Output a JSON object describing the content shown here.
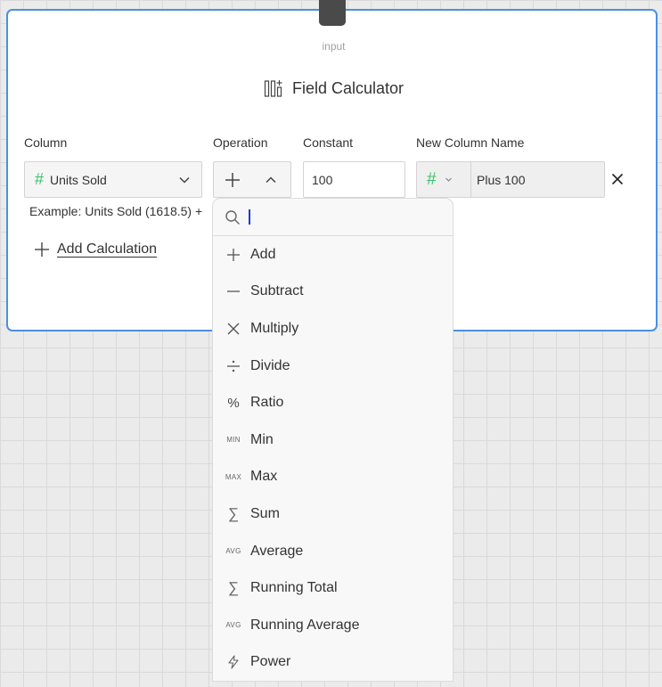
{
  "node": {
    "input_label": "input",
    "title": "Field Calculator",
    "title_icon": "field-calculator-icon"
  },
  "form": {
    "column_label": "Column",
    "operation_label": "Operation",
    "constant_label": "Constant",
    "new_column_label": "New Column Name",
    "column_value": "Units Sold",
    "column_type_icon": "#",
    "constant_value": "100",
    "new_column_type_icon": "#",
    "new_column_value": "Plus 100",
    "example": "Example: Units Sold (1618.5) +",
    "add_calculation": "Add Calculation"
  },
  "dropdown": {
    "search_placeholder": "",
    "items": [
      {
        "label": "Add",
        "icon": "plus-icon"
      },
      {
        "label": "Subtract",
        "icon": "minus-icon"
      },
      {
        "label": "Multiply",
        "icon": "times-icon"
      },
      {
        "label": "Divide",
        "icon": "divide-icon"
      },
      {
        "label": "Ratio",
        "icon": "percent-icon",
        "glyph": "%"
      },
      {
        "label": "Min",
        "icon": "min-icon",
        "glyph": "MIN"
      },
      {
        "label": "Max",
        "icon": "max-icon",
        "glyph": "MAX"
      },
      {
        "label": "Sum",
        "icon": "sigma-icon",
        "glyph": "∑"
      },
      {
        "label": "Average",
        "icon": "avg-icon",
        "glyph": "AVG"
      },
      {
        "label": "Running Total",
        "icon": "sigma-icon",
        "glyph": "∑"
      },
      {
        "label": "Running Average",
        "icon": "avg-icon",
        "glyph": "AVG"
      },
      {
        "label": "Power",
        "icon": "bolt-icon"
      }
    ]
  },
  "colors": {
    "accent_border": "#4a90e2",
    "numeric_type": "#3cc26a",
    "cursor": "#1a3ad6"
  }
}
